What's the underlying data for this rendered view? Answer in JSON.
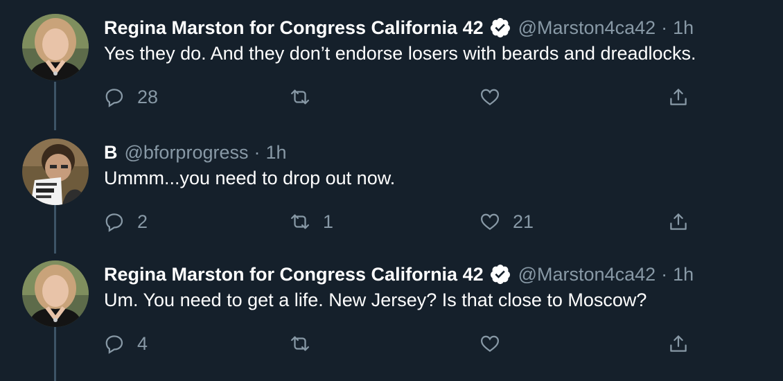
{
  "colors": {
    "background": "#15202b",
    "text_primary": "#ffffff",
    "text_secondary": "#8899a6",
    "thread_line": "#3d5466",
    "verified_badge": "#ffffff"
  },
  "tweets": [
    {
      "display_name": "Regina Marston for Congress California 42",
      "verified": true,
      "handle": "@Marston4ca42",
      "separator": "·",
      "time": "1h",
      "text": "Yes they do. And they don’t endorse losers with beards and dreadlocks.",
      "reply_count": "28",
      "retweet_count": "",
      "like_count": "",
      "avatar_icon": "avatar-regina"
    },
    {
      "display_name": "B",
      "verified": false,
      "handle": "@bforprogress",
      "separator": "·",
      "time": "1h",
      "text": "Ummm...you need to drop out now.",
      "reply_count": "2",
      "retweet_count": "1",
      "like_count": "21",
      "avatar_icon": "avatar-b"
    },
    {
      "display_name": "Regina Marston for Congress California 42",
      "verified": true,
      "handle": "@Marston4ca42",
      "separator": "·",
      "time": "1h",
      "text": "Um. You need to get a life. New Jersey? Is that close to Moscow?",
      "reply_count": "4",
      "retweet_count": "",
      "like_count": "",
      "avatar_icon": "avatar-regina"
    }
  ],
  "icons": {
    "reply": "reply-icon",
    "retweet": "retweet-icon",
    "like": "heart-icon",
    "share": "share-icon",
    "verified": "verified-badge-icon"
  }
}
